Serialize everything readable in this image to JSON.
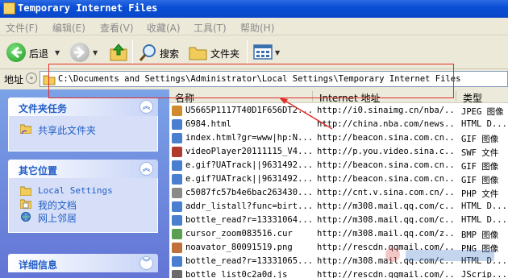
{
  "window": {
    "title": "Temporary Internet Files"
  },
  "menu": [
    "文件(F)",
    "编辑(E)",
    "查看(V)",
    "收藏(A)",
    "工具(T)",
    "帮助(H)"
  ],
  "toolbar": {
    "back": "后退",
    "search": "搜索",
    "folders": "文件夹"
  },
  "address": {
    "label": "地址",
    "path": "C:\\Documents and Settings\\Administrator\\Local Settings\\Temporary Internet Files"
  },
  "sidebar": {
    "tasks": {
      "title": "文件夹任务",
      "items": [
        "共享此文件夹"
      ]
    },
    "places": {
      "title": "其它位置",
      "items": [
        "Local Settings",
        "我的文档",
        "网上邻居"
      ]
    },
    "details": {
      "title": "详细信息"
    }
  },
  "columns": {
    "name": "名称",
    "address": "Internet 地址",
    "type": "类型"
  },
  "files": [
    {
      "name": "U5665P1117T40D1F656DT2...",
      "address": "http://i0.sinaimg.cn/nba/...",
      "type": "JPEG 图像",
      "icon": "jpeg",
      "color": "#d08a2e"
    },
    {
      "name": "6984.html",
      "address": "http://china.nba.com/news...",
      "type": "HTML D...",
      "icon": "html",
      "color": "#4a7fd0"
    },
    {
      "name": "index.html?gr=www|hp:N...",
      "address": "http://beacon.sina.com.cn...",
      "type": "GIF 图像",
      "icon": "html",
      "color": "#4a7fd0"
    },
    {
      "name": "videoPlayer20111115_V4...",
      "address": "http://p.you.video.sina.c...",
      "type": "SWF 文件",
      "icon": "swf",
      "color": "#b03a2e"
    },
    {
      "name": "e.gif?UATrack||9631492...",
      "address": "http://beacon.sina.com.cn...",
      "type": "GIF 图像",
      "icon": "gif",
      "color": "#4a7fd0"
    },
    {
      "name": "e.gif?UATrack||9631492...",
      "address": "http://beacon.sina.com.cn...",
      "type": "GIF 图像",
      "icon": "gif",
      "color": "#4a7fd0"
    },
    {
      "name": "c5087fc57b4e6bac263430...",
      "address": "http://cnt.v.sina.com.cn/...",
      "type": "PHP 文件",
      "icon": "php",
      "color": "#8a8a8a"
    },
    {
      "name": "addr_listall?func=birt...",
      "address": "http://m308.mail.qq.com/c...",
      "type": "HTML D...",
      "icon": "html",
      "color": "#4a7fd0"
    },
    {
      "name": "bottle_read?r=13331064...",
      "address": "http://m308.mail.qq.com/c...",
      "type": "HTML D...",
      "icon": "html",
      "color": "#4a7fd0"
    },
    {
      "name": "cursor_zoom083516.cur",
      "address": "http://m308.mail.qq.com/z...",
      "type": "BMP 图像",
      "icon": "cur",
      "color": "#5aa050"
    },
    {
      "name": "noavator_80091519.png",
      "address": "http://rescdn.qqmail.com/...",
      "type": "PNG 图像",
      "icon": "png",
      "color": "#c0703a"
    },
    {
      "name": "bottle_read?r=13331065...",
      "address": "http://m308.mail.qq.com/c...",
      "type": "HTML D...",
      "icon": "html",
      "color": "#4a7fd0"
    },
    {
      "name": "bottle_list0c2a0d.js",
      "address": "http://rescdn.qqmail.com/...",
      "type": "JScrip...",
      "icon": "js",
      "color": "#6a6a6a"
    }
  ]
}
